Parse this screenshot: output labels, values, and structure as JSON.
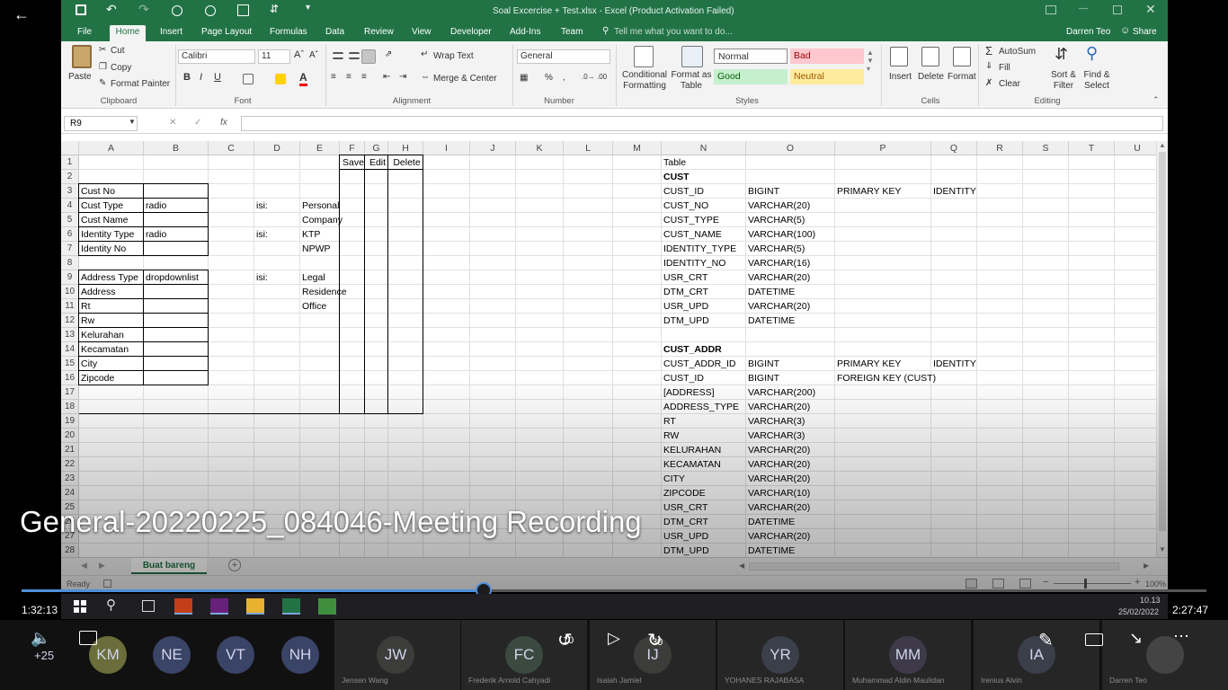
{
  "window": {
    "title": "Soal Excercise + Test.xlsx - Excel (Product Activation Failed)",
    "user": "Darren Teo"
  },
  "tabs": [
    "File",
    "Home",
    "Insert",
    "Page Layout",
    "Formulas",
    "Data",
    "Review",
    "View",
    "Developer",
    "Add-Ins",
    "Team"
  ],
  "tell_me": "Tell me what you want to do...",
  "share": "Share",
  "ribbon": {
    "clipboard": {
      "paste": "Paste",
      "cut": "Cut",
      "copy": "Copy",
      "format_painter": "Format Painter",
      "label": "Clipboard"
    },
    "font": {
      "family": "Calibri",
      "size": "11",
      "label": "Font"
    },
    "alignment": {
      "wrap": "Wrap Text",
      "merge": "Merge & Center",
      "label": "Alignment"
    },
    "number": {
      "format": "General",
      "label": "Number"
    },
    "styles": {
      "conditional": "Conditional Formatting",
      "format_table": "Format as Table",
      "normal": "Normal",
      "bad": "Bad",
      "good": "Good",
      "neutral": "Neutral",
      "label": "Styles"
    },
    "cells": {
      "insert": "Insert",
      "delete": "Delete",
      "format": "Format",
      "label": "Cells"
    },
    "editing": {
      "autosum": "AutoSum",
      "fill": "Fill",
      "clear": "Clear",
      "sort": "Sort & Filter",
      "find": "Find & Select",
      "label": "Editing"
    }
  },
  "name_box": "R9",
  "columns": [
    "A",
    "B",
    "C",
    "D",
    "E",
    "F",
    "G",
    "H",
    "I",
    "J",
    "K",
    "L",
    "M",
    "N",
    "O",
    "P",
    "Q",
    "R",
    "S",
    "T",
    "U"
  ],
  "rows": [
    "1",
    "2",
    "3",
    "4",
    "5",
    "6",
    "7",
    "8",
    "9",
    "10",
    "11",
    "12",
    "13",
    "14",
    "15",
    "16",
    "17",
    "18",
    "19",
    "20",
    "21",
    "22",
    "23",
    "24",
    "25",
    "26",
    "27",
    "28"
  ],
  "form": {
    "headers": {
      "save": "Save",
      "edit": "Edit",
      "delete": "Delete"
    },
    "fields": [
      {
        "row": 3,
        "label": "Cust No",
        "value": ""
      },
      {
        "row": 4,
        "label": "Cust Type",
        "value": "radio",
        "isi": "isi:",
        "option": "Personal"
      },
      {
        "row": 5,
        "label": "Cust Name",
        "value": "",
        "option": "Company"
      },
      {
        "row": 6,
        "label": "Identity Type",
        "value": "radio",
        "isi": "isi:",
        "option": "KTP"
      },
      {
        "row": 7,
        "label": "Identity No",
        "value": "",
        "option": "NPWP"
      },
      {
        "row": 9,
        "label": "Address Type",
        "value": "dropdownlist",
        "isi": "isi:",
        "option": "Legal"
      },
      {
        "row": 10,
        "label": "Address",
        "value": "",
        "option": "Residence"
      },
      {
        "row": 11,
        "label": "Rt",
        "value": "",
        "option": "Office"
      },
      {
        "row": 12,
        "label": "Rw",
        "value": ""
      },
      {
        "row": 13,
        "label": "Kelurahan",
        "value": ""
      },
      {
        "row": 14,
        "label": "Kecamatan",
        "value": ""
      },
      {
        "row": 15,
        "label": "City",
        "value": ""
      },
      {
        "row": 16,
        "label": "Zipcode",
        "value": ""
      }
    ]
  },
  "schema": [
    {
      "row": 1,
      "n": "Table",
      "o": "",
      "p": "",
      "q": "",
      "bold": false
    },
    {
      "row": 2,
      "n": "CUST",
      "o": "",
      "p": "",
      "q": "",
      "bold": true
    },
    {
      "row": 3,
      "n": "CUST_ID",
      "o": "BIGINT",
      "p": "PRIMARY KEY",
      "q": "IDENTITY",
      "bold": false
    },
    {
      "row": 4,
      "n": "CUST_NO",
      "o": "VARCHAR(20)",
      "p": "",
      "q": "",
      "bold": false
    },
    {
      "row": 5,
      "n": "CUST_TYPE",
      "o": "VARCHAR(5)",
      "p": "",
      "q": "",
      "bold": false
    },
    {
      "row": 6,
      "n": "CUST_NAME",
      "o": "VARCHAR(100)",
      "p": "",
      "q": "",
      "bold": false
    },
    {
      "row": 7,
      "n": "IDENTITY_TYPE",
      "o": "VARCHAR(5)",
      "p": "",
      "q": "",
      "bold": false
    },
    {
      "row": 8,
      "n": "IDENTITY_NO",
      "o": "VARCHAR(16)",
      "p": "",
      "q": "",
      "bold": false
    },
    {
      "row": 9,
      "n": "USR_CRT",
      "o": "VARCHAR(20)",
      "p": "",
      "q": "",
      "bold": false
    },
    {
      "row": 10,
      "n": "DTM_CRT",
      "o": "DATETIME",
      "p": "",
      "q": "",
      "bold": false
    },
    {
      "row": 11,
      "n": "USR_UPD",
      "o": "VARCHAR(20)",
      "p": "",
      "q": "",
      "bold": false
    },
    {
      "row": 12,
      "n": "DTM_UPD",
      "o": "DATETIME",
      "p": "",
      "q": "",
      "bold": false
    },
    {
      "row": 14,
      "n": "CUST_ADDR",
      "o": "",
      "p": "",
      "q": "",
      "bold": true
    },
    {
      "row": 15,
      "n": "CUST_ADDR_ID",
      "o": "BIGINT",
      "p": "PRIMARY KEY",
      "q": "IDENTITY",
      "bold": false
    },
    {
      "row": 16,
      "n": "CUST_ID",
      "o": "BIGINT",
      "p": "FOREIGN KEY (CUST)",
      "q": "",
      "bold": false
    },
    {
      "row": 17,
      "n": "[ADDRESS]",
      "o": "VARCHAR(200)",
      "p": "",
      "q": "",
      "bold": false
    },
    {
      "row": 18,
      "n": "ADDRESS_TYPE",
      "o": "VARCHAR(20)",
      "p": "",
      "q": "",
      "bold": false
    },
    {
      "row": 19,
      "n": "RT",
      "o": "VARCHAR(3)",
      "p": "",
      "q": "",
      "bold": false
    },
    {
      "row": 20,
      "n": "RW",
      "o": "VARCHAR(3)",
      "p": "",
      "q": "",
      "bold": false
    },
    {
      "row": 21,
      "n": "KELURAHAN",
      "o": "VARCHAR(20)",
      "p": "",
      "q": "",
      "bold": false
    },
    {
      "row": 22,
      "n": "KECAMATAN",
      "o": "VARCHAR(20)",
      "p": "",
      "q": "",
      "bold": false
    },
    {
      "row": 23,
      "n": "CITY",
      "o": "VARCHAR(20)",
      "p": "",
      "q": "",
      "bold": false
    },
    {
      "row": 24,
      "n": "ZIPCODE",
      "o": "VARCHAR(10)",
      "p": "",
      "q": "",
      "bold": false
    },
    {
      "row": 25,
      "n": "USR_CRT",
      "o": "VARCHAR(20)",
      "p": "",
      "q": "",
      "bold": false
    },
    {
      "row": 26,
      "n": "DTM_CRT",
      "o": "DATETIME",
      "p": "",
      "q": "",
      "bold": false
    },
    {
      "row": 27,
      "n": "USR_UPD",
      "o": "VARCHAR(20)",
      "p": "",
      "q": "",
      "bold": false
    },
    {
      "row": 28,
      "n": "DTM_UPD",
      "o": "DATETIME",
      "p": "",
      "q": "",
      "bold": false
    }
  ],
  "sheet_tab": "Buat bareng",
  "status": {
    "ready": "Ready",
    "zoom": "100%"
  },
  "clock": {
    "time": "10.13",
    "date": "25/02/2022"
  },
  "player": {
    "title": "General-20220225_084046-Meeting Recording",
    "elapsed": "1:32:13",
    "duration": "2:27:47",
    "progress": 0.39,
    "extra_count": "+25",
    "rewind": "10",
    "forward": "30"
  },
  "participants": [
    {
      "initials": "KM",
      "name": "",
      "color": "#6b6e3a"
    },
    {
      "initials": "NE",
      "name": "",
      "color": "#3a4466"
    },
    {
      "initials": "VT",
      "name": "",
      "color": "#3a4466"
    },
    {
      "initials": "NH",
      "name": "",
      "color": "#3a4466"
    },
    {
      "initials": "JW",
      "name": "Jensen Wang",
      "color": "#3c3c3a"
    },
    {
      "initials": "FC",
      "name": "Frederik Arnold Cahyadi",
      "color": "#3a4a40"
    },
    {
      "initials": "IJ",
      "name": "Isaiah Jamiel",
      "color": "#3c3c3a"
    },
    {
      "initials": "YR",
      "name": "YOHANES RAJABASA",
      "color": "#3a3f4a"
    },
    {
      "initials": "MM",
      "name": "Muhammad Aldin Maulidan",
      "color": "#3e3a4a"
    },
    {
      "initials": "IA",
      "name": "Irenius Alvin",
      "color": "#3a3f4a"
    },
    {
      "initials": "",
      "name": "Darren Teo",
      "color": "#444"
    }
  ]
}
